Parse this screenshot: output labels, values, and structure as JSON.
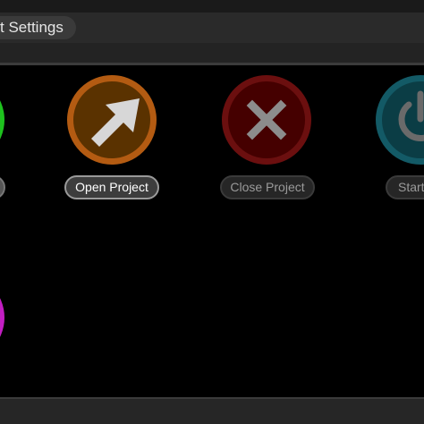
{
  "header": {
    "title": "t Settings"
  },
  "actions": [
    {
      "id": "open-project",
      "label": "Open Project",
      "icon": "arrow-up-right-icon",
      "ring_color": "#b35b12",
      "fill_color": "#5a3200",
      "active": true
    },
    {
      "id": "close-project",
      "label": "Close Project",
      "icon": "x-close-icon",
      "ring_color": "#6b0f0f",
      "fill_color": "#450000",
      "active": false
    },
    {
      "id": "start",
      "label": "Start",
      "icon": "power-icon",
      "ring_color": "#135a66",
      "fill_color": "#0b3d45",
      "active": false
    }
  ],
  "partial_buttons": [
    {
      "id": "green",
      "color": "#1ec21e"
    },
    {
      "id": "magenta",
      "color": "#c21ec2"
    }
  ]
}
